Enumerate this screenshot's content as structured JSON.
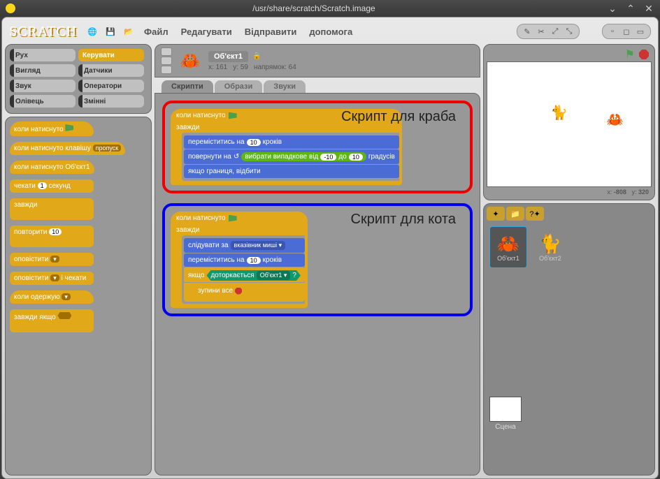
{
  "window": {
    "title": "/usr/share/scratch/Scratch.image"
  },
  "logo": "SCRATCH",
  "menu": {
    "file": "Файл",
    "edit": "Редагувати",
    "share": "Відправити",
    "help": "допомога"
  },
  "categories": {
    "motion": "Рух",
    "control": "Керувати",
    "looks": "Вигляд",
    "sensing": "Датчики",
    "sound": "Звук",
    "operators": "Оператори",
    "pen": "Олівець",
    "variables": "Змінні"
  },
  "palette": {
    "when_flag": "коли натиснуто",
    "when_key": "коли натиснуто клавішу",
    "when_key_arg": "пропуск",
    "when_clicked": "коли натиснуто Об'єкт1",
    "wait_a": "чекати",
    "wait_b": "секунд",
    "wait_val": "1",
    "forever": "завжди",
    "repeat": "повторити",
    "repeat_val": "10",
    "broadcast": "оповістити",
    "broadcast_wait": "і чекати",
    "when_receive": "коли одержую",
    "forever_if": "завжди якщо"
  },
  "sprite": {
    "name": "Об'єкт1",
    "x_lbl": "x:",
    "x": "161",
    "y_lbl": "y:",
    "y": "59",
    "dir_lbl": "напрямок:",
    "dir": "64"
  },
  "tabs": {
    "scripts": "Скрипти",
    "costumes": "Образи",
    "sounds": "Звуки"
  },
  "script1": {
    "label": "Скрипт для краба",
    "hat": "коли натиснуто",
    "forever": "завжди",
    "move_a": "переміститись на",
    "move_val": "10",
    "move_b": "кроків",
    "turn_a": "повернути на",
    "rand_a": "вибрати випадкове від",
    "rand_lo": "-10",
    "rand_mid": "до",
    "rand_hi": "10",
    "turn_b": "градусів",
    "bounce": "якщо границя, відбити"
  },
  "script2": {
    "label": "Скрипт для кота",
    "hat": "коли натиснуто",
    "forever": "завжди",
    "point_a": "слідувати за",
    "point_arg": "вказівник миші",
    "move_a": "переміститись на",
    "move_val": "10",
    "move_b": "кроків",
    "if": "якщо",
    "touch_a": "доторкається",
    "touch_arg": "Об'єкт1",
    "touch_q": "?",
    "stop": "зупини все"
  },
  "stage": {
    "mouse_x_lbl": "x:",
    "mouse_x": "-808",
    "mouse_y_lbl": "y:",
    "mouse_y": "320"
  },
  "sprites": {
    "s1": "Об'єкт1",
    "s2": "Об'єкт2",
    "stage_label": "Сцена"
  }
}
